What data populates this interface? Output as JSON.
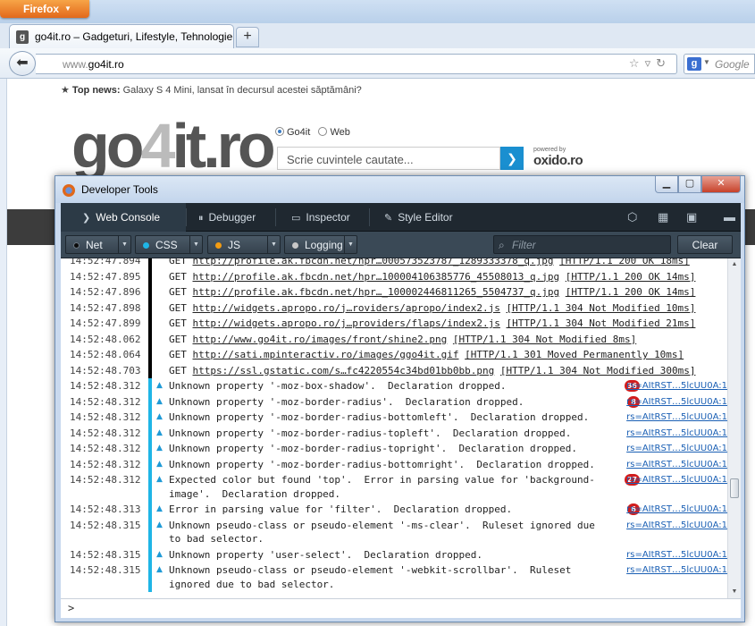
{
  "browser": {
    "menu_button": "Firefox",
    "tab_title": "go4it.ro – Gadgeturi, Lifestyle, Tehnologie",
    "favicon_letter": "g",
    "url_prefix": "www.",
    "url_domain": "go4it.ro",
    "search_engine_placeholder": "Google"
  },
  "page": {
    "top_news_label": "Top news:",
    "top_news_text": "Galaxy S 4 Mini, lansat în decursul acestei săptămâni?",
    "logo_a": "go",
    "logo_b": "4",
    "logo_c": "it.ro",
    "radio_go4it": "Go4it",
    "radio_web": "Web",
    "search_placeholder": "Scrie cuvintele cautate...",
    "powered_by": "powered by",
    "powered_brand": "oxido.ro"
  },
  "devtools": {
    "window_title": "Developer Tools",
    "tabs": [
      "Web Console",
      "Debugger",
      "Inspector",
      "Style Editor"
    ],
    "filters": {
      "net": "Net",
      "css": "CSS",
      "js": "JS",
      "logging": "Logging",
      "net_color": "#0a0a0a",
      "css_color": "#1fb5e6",
      "js_color": "#f39c12",
      "logging_color": "#c8c8c8"
    },
    "filter_placeholder": "Filter",
    "clear_label": "Clear",
    "prompt": ">",
    "rows": [
      {
        "type": "net",
        "ts": "14:52:47.894",
        "method": "GET",
        "url": "http://profile.ak.fbcdn.net/hpr…000573523787_1289333378_q.jpg",
        "status": "[HTTP/1.1 200 OK 18ms]"
      },
      {
        "type": "net",
        "ts": "14:52:47.895",
        "method": "GET",
        "url": "http://profile.ak.fbcdn.net/hpr…100004106385776_45508013_q.jpg",
        "status": "[HTTP/1.1 200 OK 14ms]"
      },
      {
        "type": "net",
        "ts": "14:52:47.896",
        "method": "GET",
        "url": "http://profile.ak.fbcdn.net/hpr…_100002446811265_5504737_q.jpg",
        "status": "[HTTP/1.1 200 OK 14ms]"
      },
      {
        "type": "net",
        "ts": "14:52:47.898",
        "method": "GET",
        "url": "http://widgets.apropo.ro/j…roviders/apropo/index2.js",
        "status": "[HTTP/1.1 304 Not Modified 10ms]"
      },
      {
        "type": "net",
        "ts": "14:52:47.899",
        "method": "GET",
        "url": "http://widgets.apropo.ro/j…providers/flaps/index2.js",
        "status": "[HTTP/1.1 304 Not Modified 21ms]"
      },
      {
        "type": "net",
        "ts": "14:52:48.062",
        "method": "GET",
        "url": "http://www.go4it.ro/images/front/shine2.png",
        "status": "[HTTP/1.1 304 Not Modified 8ms]"
      },
      {
        "type": "net",
        "ts": "14:52:48.064",
        "method": "GET",
        "url": "http://sati.mpinteractiv.ro/images/ggo4it.gif",
        "status": "[HTTP/1.1 301 Moved Permanently 10ms]"
      },
      {
        "type": "net",
        "ts": "14:52:48.703",
        "method": "GET",
        "url": "https://ssl.gstatic.com/s…fc4220554c34bd01bb0bb.png",
        "status": "[HTTP/1.1 304 Not Modified 300ms]"
      },
      {
        "type": "css",
        "ts": "14:52:48.312",
        "msg": "Unknown property '-moz-box-shadow'.  Declaration dropped.",
        "badge": "36",
        "src": "rs=AItRST…5lcUU0A:1"
      },
      {
        "type": "css",
        "ts": "14:52:48.312",
        "msg": "Unknown property '-moz-border-radius'.  Declaration dropped.",
        "badge": "8",
        "src": "rs=AItRST…5lcUU0A:1"
      },
      {
        "type": "css",
        "ts": "14:52:48.312",
        "msg": "Unknown property '-moz-border-radius-bottomleft'.  Declaration dropped.",
        "badge": "",
        "src": "rs=AItRST…5lcUU0A:1"
      },
      {
        "type": "css",
        "ts": "14:52:48.312",
        "msg": "Unknown property '-moz-border-radius-topleft'.  Declaration dropped.",
        "badge": "",
        "src": "rs=AItRST…5lcUU0A:1"
      },
      {
        "type": "css",
        "ts": "14:52:48.312",
        "msg": "Unknown property '-moz-border-radius-topright'.  Declaration dropped.",
        "badge": "",
        "src": "rs=AItRST…5lcUU0A:1"
      },
      {
        "type": "css",
        "ts": "14:52:48.312",
        "msg": "Unknown property '-moz-border-radius-bottomright'.  Declaration dropped.",
        "badge": "",
        "src": "rs=AItRST…5lcUU0A:1"
      },
      {
        "type": "css",
        "ts": "14:52:48.312",
        "msg": "Expected color but found 'top'.  Error in parsing value for 'background-image'.  Declaration dropped.",
        "badge": "27",
        "src": "rs=AItRST…5lcUU0A:1"
      },
      {
        "type": "css",
        "ts": "14:52:48.313",
        "msg": "Error in parsing value for 'filter'.  Declaration dropped.",
        "badge": "6",
        "src": "rs=AItRST…5lcUU0A:1"
      },
      {
        "type": "css",
        "ts": "14:52:48.315",
        "msg": "Unknown pseudo-class or pseudo-element '-ms-clear'.  Ruleset ignored due to bad selector.",
        "badge": "",
        "src": "rs=AItRST…5lcUU0A:1"
      },
      {
        "type": "css",
        "ts": "14:52:48.315",
        "msg": "Unknown property 'user-select'.  Declaration dropped.",
        "badge": "",
        "src": "rs=AItRST…5lcUU0A:1"
      },
      {
        "type": "css",
        "ts": "14:52:48.315",
        "msg": "Unknown pseudo-class or pseudo-element '-webkit-scrollbar'.  Ruleset ignored due to bad selector.",
        "badge": "",
        "src": "rs=AItRST…5lcUU0A:1"
      }
    ]
  }
}
